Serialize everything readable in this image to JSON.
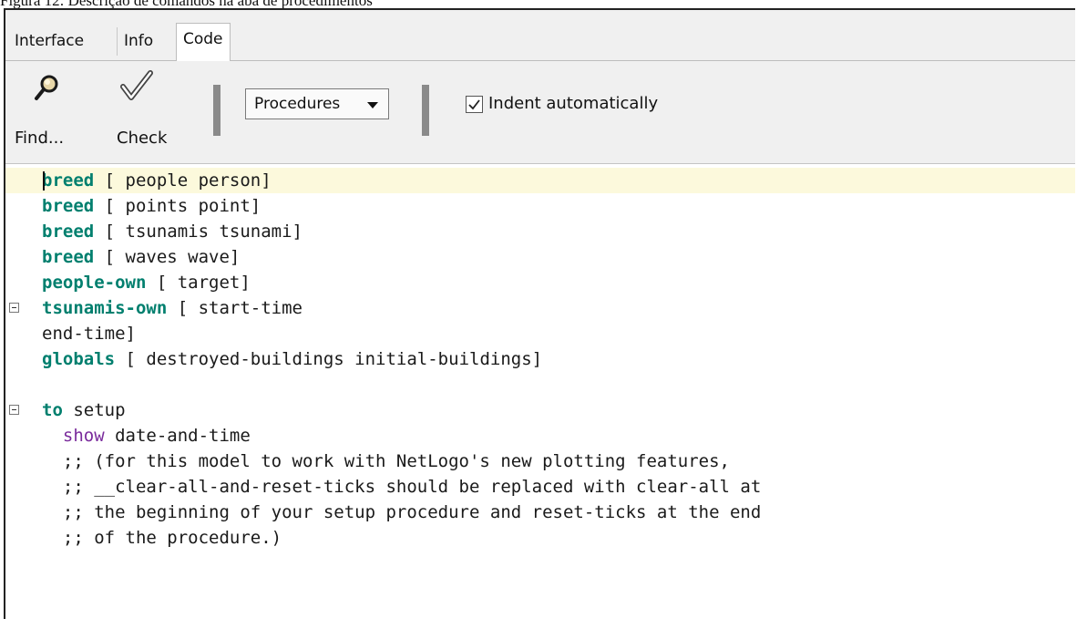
{
  "figure_caption": "Figura 12: Descrição de comandos na aba de procedimentos",
  "tabs": [
    {
      "label": "Interface"
    },
    {
      "label": "Info"
    },
    {
      "label": "Code",
      "selected": true
    }
  ],
  "toolbar": {
    "find_label": "Find...",
    "check_label": "Check",
    "procedures_label": "Procedures",
    "indent_label": "Indent automatically",
    "indent_checked": true
  },
  "code_lines": [
    {
      "k": "breed",
      "rest": " [ people person]",
      "kw_class": "kw"
    },
    {
      "k": "breed",
      "rest": " [ points point]",
      "kw_class": "kw"
    },
    {
      "k": "breed",
      "rest": " [ tsunamis tsunami]",
      "kw_class": "kw"
    },
    {
      "k": "breed",
      "rest": " [ waves wave]",
      "kw_class": "kw"
    },
    {
      "k": "people-own",
      "rest": " [ target]",
      "kw_class": "kw"
    },
    {
      "k": "tsunamis-own",
      "rest": " [ start-time",
      "kw_class": "kw",
      "fold": true
    },
    {
      "k": "",
      "rest": "end-time]",
      "kw_class": "kw"
    },
    {
      "k": "globals",
      "rest": " [ destroyed-buildings initial-buildings]",
      "kw_class": "kw"
    },
    {
      "k": "",
      "rest": "",
      "kw_class": "kw"
    },
    {
      "k": "to",
      "rest": " setup",
      "kw_class": "kw",
      "fold": true
    },
    {
      "k": "  show",
      "rest": " date-and-time",
      "kw_class": "kw2"
    },
    {
      "k": "",
      "rest": "  ;; (for this model to work with NetLogo's new plotting features,",
      "kw_class": "kw"
    },
    {
      "k": "",
      "rest": "  ;; __clear-all-and-reset-ticks should be replaced with clear-all at",
      "kw_class": "kw"
    },
    {
      "k": "",
      "rest": "  ;; the beginning of your setup procedure and reset-ticks at the end",
      "kw_class": "kw"
    },
    {
      "k": "",
      "rest": "  ;; of the procedure.)",
      "kw_class": "kw"
    }
  ],
  "icons": {
    "find": "magnifier-icon",
    "check": "checkmark-icon"
  }
}
